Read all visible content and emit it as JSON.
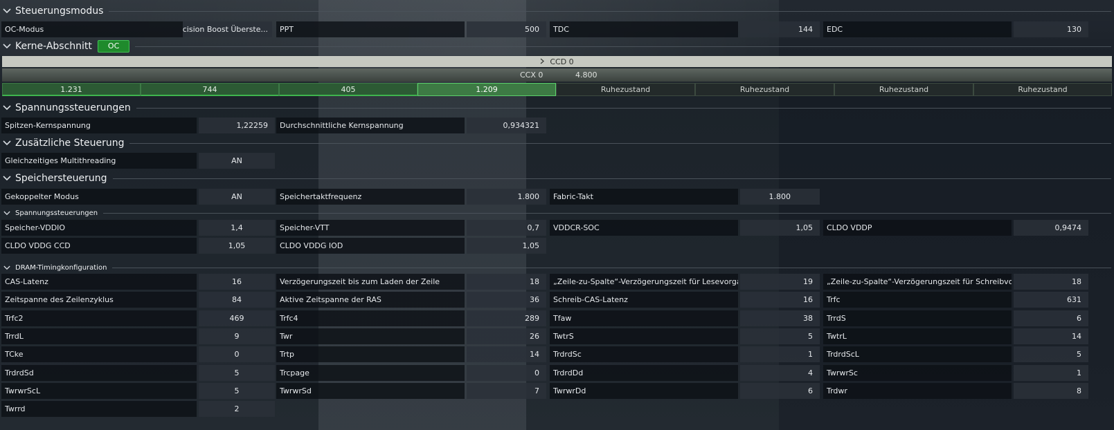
{
  "sections": {
    "control_mode": "Steuerungsmodus",
    "cores": "Kerne-Abschnitt",
    "cores_badge": "OC",
    "voltage": "Spannungssteuerungen",
    "additional": "Zusätzliche Steuerung",
    "memory": "Speichersteuerung",
    "mem_voltage": "Spannungssteuerungen",
    "dram_timing": "DRAM-Timingkonfiguration"
  },
  "control_mode": {
    "oc_mode_label": "OC-Modus",
    "oc_mode_value": "Precision Boost Überste...",
    "ppt_label": "PPT",
    "ppt_value": "500",
    "tdc_label": "TDC",
    "tdc_value": "144",
    "edc_label": "EDC",
    "edc_value": "130"
  },
  "cores": {
    "ccd_label": "CCD 0",
    "ccx_label": "CCX 0",
    "ccx_freq": "4.800",
    "core_values": [
      "1.231",
      "744",
      "405",
      "1.209",
      "Ruhezustand",
      "Ruhezustand",
      "Ruhezustand",
      "Ruhezustand"
    ]
  },
  "voltage": {
    "peak_label": "Spitzen-Kernspannung",
    "peak_value": "1,22259",
    "avg_label": "Durchschnittliche Kernspannung",
    "avg_value": "0,934321"
  },
  "additional": {
    "smt_label": "Gleichzeitiges Multithreading",
    "smt_value": "AN"
  },
  "memory": {
    "coupled_label": "Gekoppelter Modus",
    "coupled_value": "AN",
    "memclk_label": "Speichertaktfrequenz",
    "memclk_value": "1.800",
    "fclk_label": "Fabric-Takt",
    "fclk_value": "1.800"
  },
  "mem_voltage": [
    [
      "Speicher-VDDIO",
      "1,4"
    ],
    [
      "Speicher-VTT",
      "0,7"
    ],
    [
      "VDDCR-SOC",
      "1,05"
    ],
    [
      "CLDO VDDP",
      "0,9474"
    ],
    [
      "CLDO VDDG CCD",
      "1,05"
    ],
    [
      "CLDO VDDG IOD",
      "1,05"
    ]
  ],
  "dram": [
    [
      "CAS-Latenz",
      "16"
    ],
    [
      "Verzögerungszeit bis zum Laden der Zeile",
      "18"
    ],
    [
      "„Zeile-zu-Spalte“-Verzögerungszeit für Lesevorgang",
      "19"
    ],
    [
      "„Zeile-zu-Spalte“-Verzögerungszeit für Schreibvorgang",
      "18"
    ],
    [
      "Zeitspanne des Zeilenzyklus",
      "84"
    ],
    [
      "Aktive Zeitspanne der RAS",
      "36"
    ],
    [
      "Schreib-CAS-Latenz",
      "16"
    ],
    [
      "Trfc",
      "631"
    ],
    [
      "Trfc2",
      "469"
    ],
    [
      "Trfc4",
      "289"
    ],
    [
      "Tfaw",
      "38"
    ],
    [
      "TrrdS",
      "6"
    ],
    [
      "TrrdL",
      "9"
    ],
    [
      "Twr",
      "26"
    ],
    [
      "TwtrS",
      "5"
    ],
    [
      "TwtrL",
      "14"
    ],
    [
      "TCke",
      "0"
    ],
    [
      "Trtp",
      "14"
    ],
    [
      "TrdrdSc",
      "1"
    ],
    [
      "TrdrdScL",
      "5"
    ],
    [
      "TrdrdSd",
      "5"
    ],
    [
      "Trcpage",
      "0"
    ],
    [
      "TrdrdDd",
      "4"
    ],
    [
      "TwrwrSc",
      "1"
    ],
    [
      "TwrwrScL",
      "5"
    ],
    [
      "TwrwrSd",
      "7"
    ],
    [
      "TwrwrDd",
      "6"
    ],
    [
      "Trdwr",
      "8"
    ],
    [
      "Twrrd",
      "2"
    ]
  ],
  "colors": {
    "accent_green": "#1f8a2c",
    "active_core": "#2c5a34"
  }
}
